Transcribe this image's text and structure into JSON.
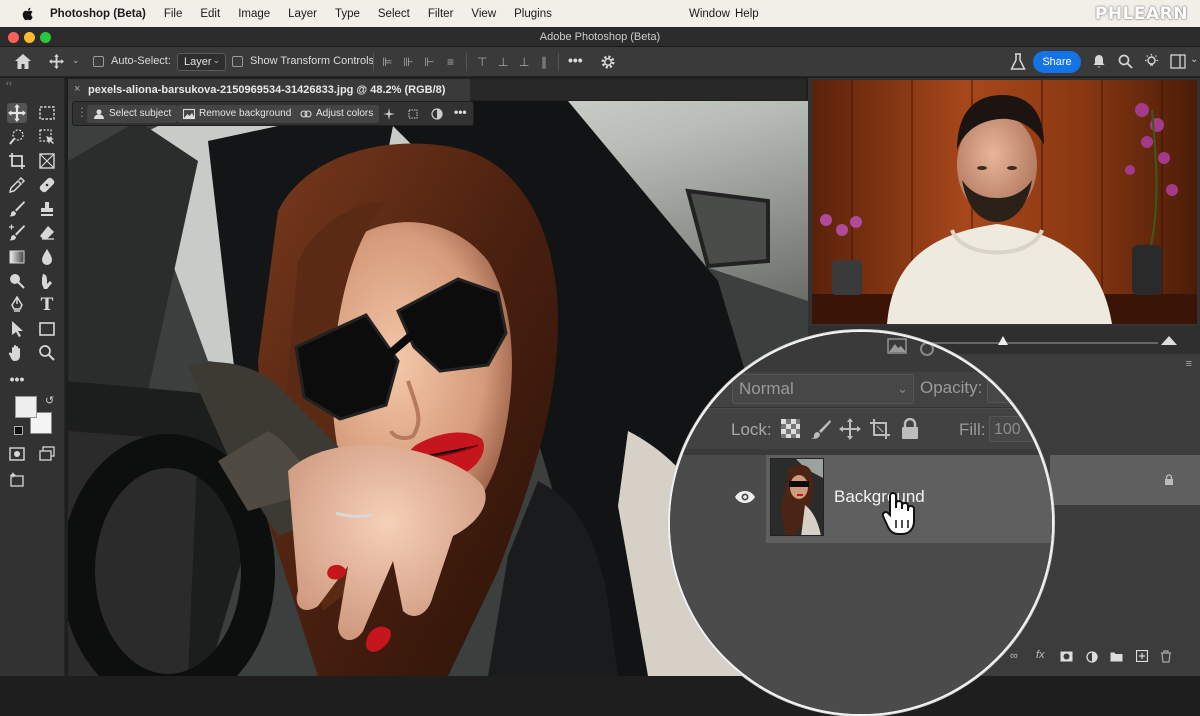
{
  "menubar": {
    "app_name": "Photoshop (Beta)",
    "items": [
      "File",
      "Edit",
      "Image",
      "Layer",
      "Type",
      "Select",
      "Filter",
      "View",
      "Plugins"
    ],
    "right_items": [
      "Window",
      "Help"
    ],
    "watermark": "PHLEARN"
  },
  "window": {
    "title": "Adobe Photoshop (Beta)"
  },
  "options_bar": {
    "auto_select_label": "Auto-Select:",
    "auto_select_value": "Layer",
    "show_transform_label": "Show Transform Controls",
    "share_label": "Share"
  },
  "document": {
    "tab_title": "pexels-aliona-barsukova-2150969534-31426833.jpg @ 48.2% (RGB/8)",
    "zoom": "48.2%"
  },
  "taskbar": {
    "select_subject": "Select subject",
    "remove_background": "Remove background",
    "adjust_colors": "Adjust colors"
  },
  "layers": {
    "blend_mode": "Normal",
    "opacity_label": "Opacity:",
    "lock_label": "Lock:",
    "fill_label": "Fill:",
    "fill_value": "100",
    "layer_name": "Background"
  },
  "colors": {
    "accent": "#1473e6",
    "panel": "#323232",
    "canvas": "#282828",
    "lips": "#c4161c"
  }
}
